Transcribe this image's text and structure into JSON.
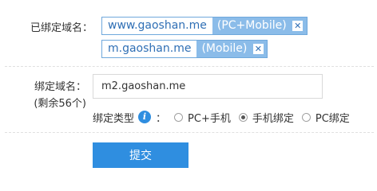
{
  "bound_domains": {
    "label": "已绑定域名：",
    "items": [
      {
        "domain": "www.gaoshan.me",
        "mode": "(PC+Mobile)",
        "remove_icon": "close-icon"
      },
      {
        "domain": "m.gaoshan.me",
        "mode": "(Mobile)",
        "remove_icon": "close-icon"
      }
    ]
  },
  "bind_form": {
    "label": "绑定域名：",
    "remaining": "(剩余56个)",
    "domain_value": "m2.gaoshan.me",
    "type_label": "绑定类型",
    "type_colon": "：",
    "info_icon": "info-icon",
    "options": [
      {
        "label": "PC+手机",
        "selected": false
      },
      {
        "label": "手机绑定",
        "selected": true
      },
      {
        "label": "PC绑定",
        "selected": false
      }
    ],
    "submit_label": "提交"
  },
  "colors": {
    "accent": "#2f8ee0",
    "tag_border": "#6fa8dc",
    "tag_fill": "#8bbce9",
    "domain_text": "#2f6fb5"
  }
}
